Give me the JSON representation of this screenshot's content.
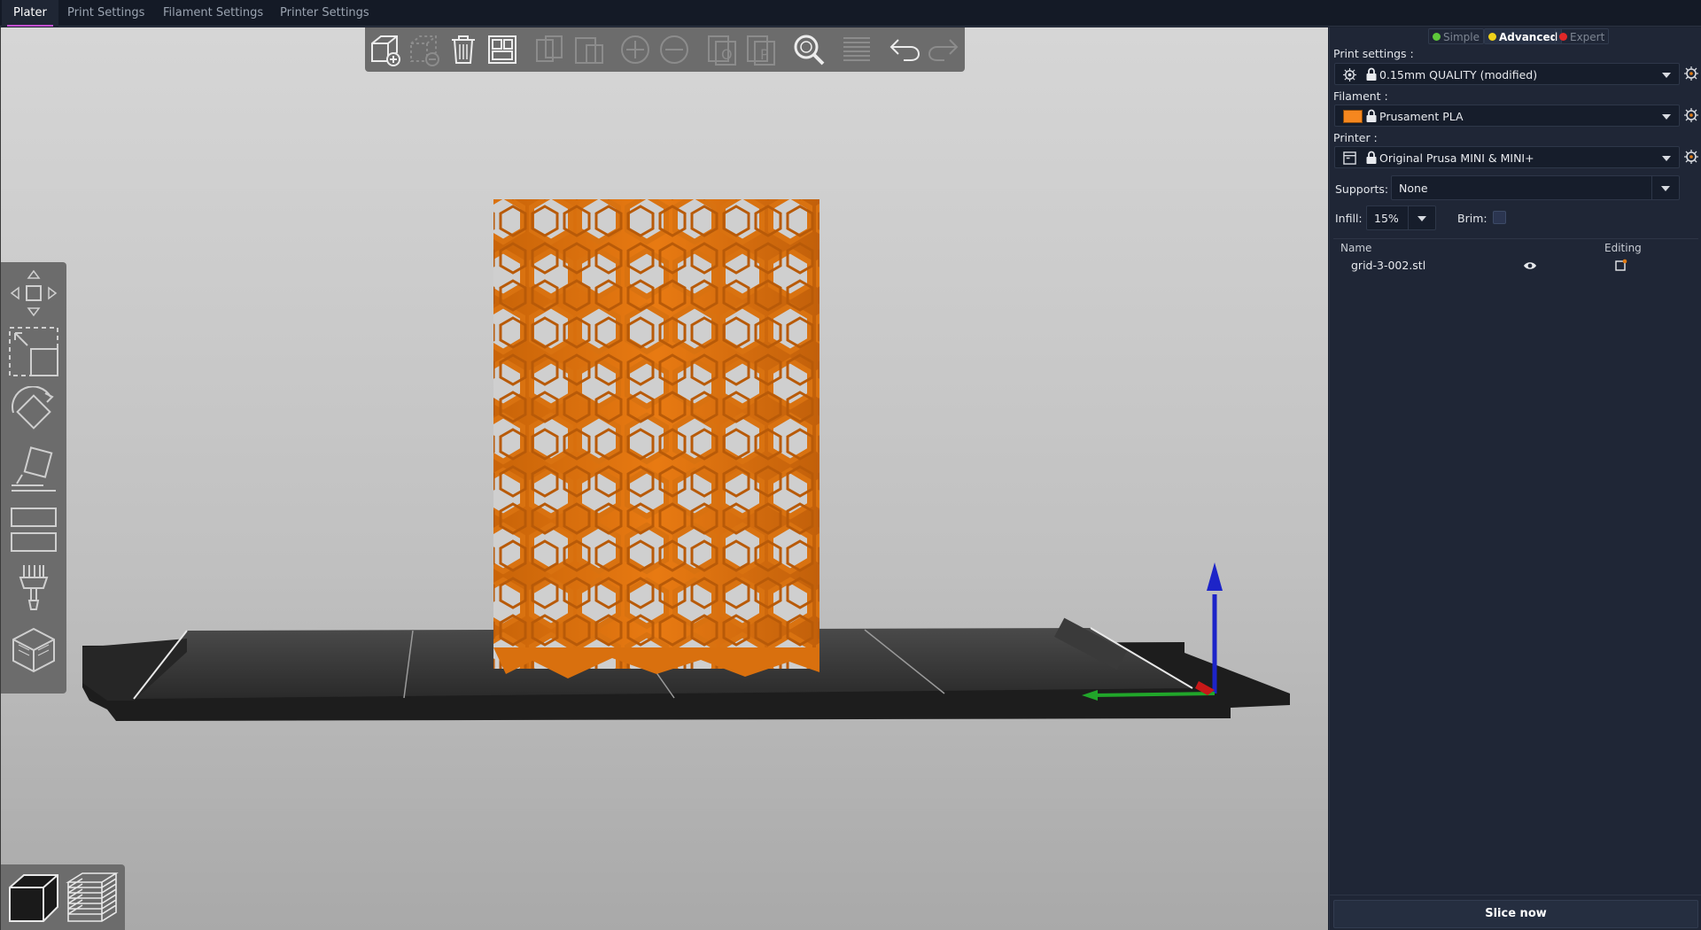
{
  "tabs": [
    {
      "label": "Plater",
      "active": true
    },
    {
      "label": "Print Settings",
      "active": false
    },
    {
      "label": "Filament Settings",
      "active": false
    },
    {
      "label": "Printer Settings",
      "active": false
    }
  ],
  "toolbar": {
    "buttons": [
      {
        "name": "add-icon",
        "enabled": true
      },
      {
        "name": "delete-icon",
        "enabled": false
      },
      {
        "name": "delete-all-icon",
        "enabled": true
      },
      {
        "name": "arrange-icon",
        "enabled": true
      },
      {
        "name": "copy-icon",
        "enabled": false
      },
      {
        "name": "paste-icon",
        "enabled": false
      },
      {
        "name": "add-instance-icon",
        "enabled": false
      },
      {
        "name": "remove-instance-icon",
        "enabled": false
      },
      {
        "name": "split-to-objects-icon",
        "enabled": false
      },
      {
        "name": "split-to-parts-icon",
        "enabled": false
      },
      {
        "name": "search-icon",
        "enabled": true
      },
      {
        "name": "layers-editing-icon",
        "enabled": false
      },
      {
        "name": "undo-icon",
        "enabled": true
      },
      {
        "name": "redo-icon",
        "enabled": false
      }
    ]
  },
  "colors": {
    "accent": "#c24fd0",
    "model": "#e87a12",
    "simple_dot": "#5ec93a",
    "advanced_dot": "#f0d21a",
    "expert_dot": "#e02828",
    "filament_swatch": "#f5871f",
    "axis_z": "#1d24c8",
    "axis_x": "#c81818",
    "axis_y": "#21a62a"
  },
  "modes": {
    "simple": "Simple",
    "advanced": "Advanced",
    "expert": "Expert",
    "active": "Advanced"
  },
  "print_settings": {
    "label": "Print settings :",
    "value": "0.15mm QUALITY (modified)"
  },
  "filament": {
    "label": "Filament :",
    "value": "Prusament PLA"
  },
  "printer": {
    "label": "Printer :",
    "value": "Original Prusa MINI & MINI+"
  },
  "supports": {
    "label": "Supports:",
    "value": "None"
  },
  "infill": {
    "label": "Infill:",
    "value": "15%"
  },
  "brim": {
    "label": "Brim:",
    "checked": false
  },
  "object_list": {
    "col_name": "Name",
    "col_editing": "Editing",
    "items": [
      {
        "name": "grid-3-002.stl",
        "visible": true
      }
    ]
  },
  "slice_button": "Slice now"
}
